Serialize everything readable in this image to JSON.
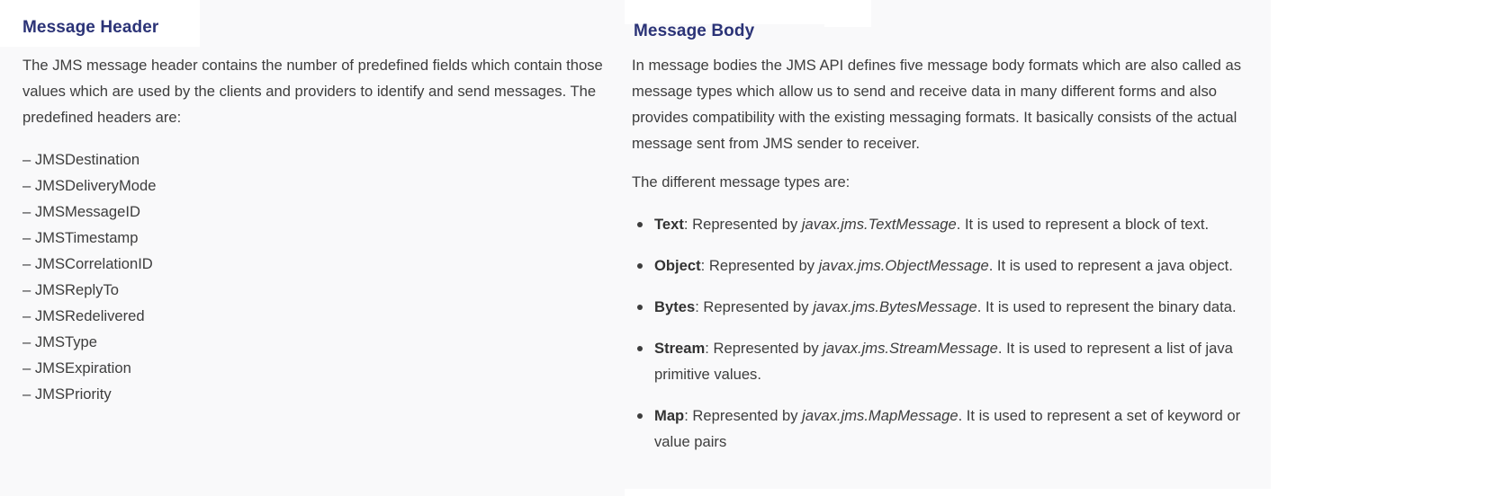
{
  "message_header": {
    "title": "Message Header",
    "intro": "The JMS message header contains the number of predefined fields which contain those values which are used by the clients and providers to identify and send messages. The predefined headers are:",
    "headers": [
      "– JMSDestination",
      "– JMSDeliveryMode",
      "– JMSMessageID",
      "– JMSTimestamp",
      "– JMSCorrelationID",
      "– JMSReplyTo",
      "– JMSRedelivered",
      "– JMSType",
      "– JMSExpiration",
      "– JMSPriority"
    ]
  },
  "message_body": {
    "title": "Message Body",
    "intro": "In message bodies the JMS API defines five message body formats which are also called as message types which allow us to send and receive data in many different forms and also provides compatibility with the existing messaging formats. It basically consists of the actual message sent from JMS sender to receiver.",
    "types_intro": "The different message types are:",
    "types": [
      {
        "name": "Text",
        "prefix": ": Represented by ",
        "class_name": "javax.jms.TextMessage",
        "description": ". It is used to represent a block of text."
      },
      {
        "name": "Object",
        "prefix": ": Represented by ",
        "class_name": "javax.jms.ObjectMessage",
        "description": ". It is used to represent a java object."
      },
      {
        "name": "Bytes",
        "prefix": ": Represented by ",
        "class_name": "javax.jms.BytesMessage",
        "description": ". It is used to represent the binary data."
      },
      {
        "name": "Stream",
        "prefix": ": Represented by ",
        "class_name": "javax.jms.StreamMessage",
        "description": ". It is used to represent a list of java primitive values."
      },
      {
        "name": "Map",
        "prefix": ": Represented by ",
        "class_name": "javax.jms.MapMessage",
        "description": ". It is used to represent a set of keyword or value pairs"
      }
    ]
  },
  "colors": {
    "heading": "#2b3377",
    "text": "#3d3d3d",
    "panel_background": "#f9f9fa"
  }
}
